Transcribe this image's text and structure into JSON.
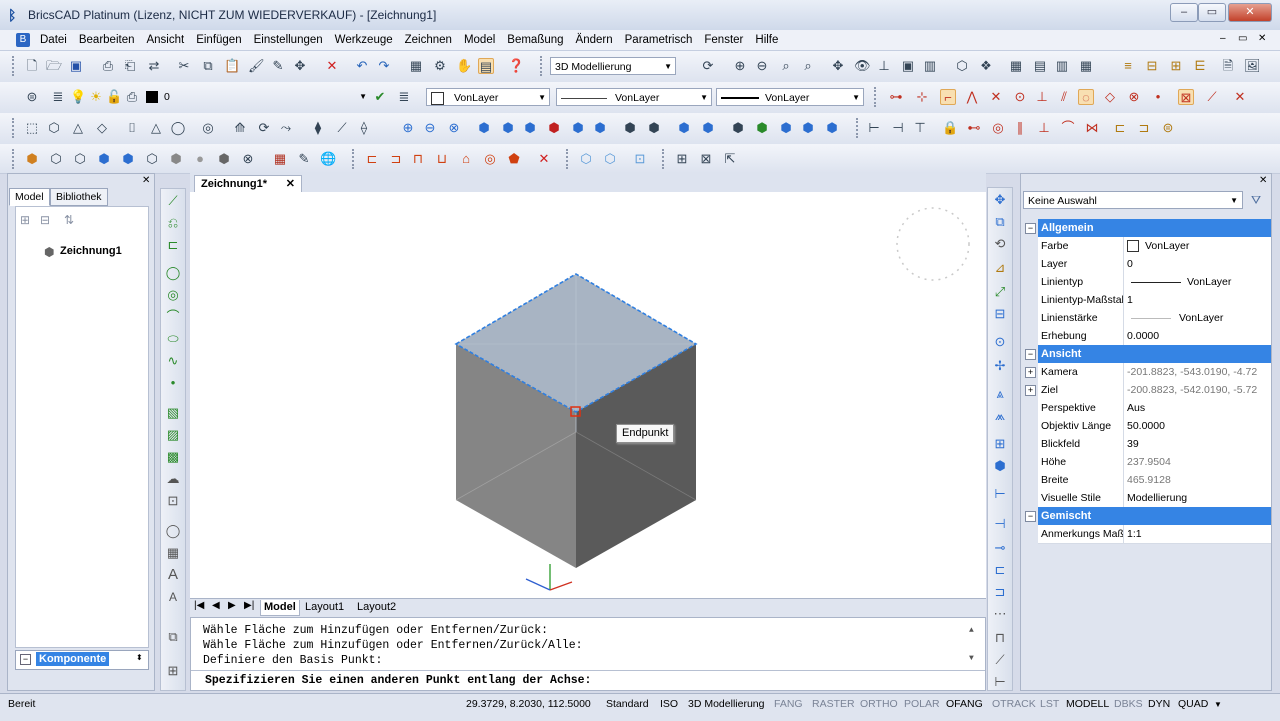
{
  "window": {
    "title": "BricsCAD Platinum (Lizenz, NICHT ZUM WIEDERVERKAUF) - [Zeichnung1]"
  },
  "menu": [
    "Datei",
    "Bearbeiten",
    "Ansicht",
    "Einfügen",
    "Einstellungen",
    "Werkzeuge",
    "Zeichnen",
    "Model",
    "Bemaßung",
    "Ändern",
    "Parametrisch",
    "Fenster",
    "Hilfe"
  ],
  "toolbar": {
    "workspace": "3D Modellierung",
    "layer": "0",
    "color": "VonLayer",
    "linetype": "VonLayer",
    "lineweight": "VonLayer"
  },
  "left_panel": {
    "tabs": [
      "Model",
      "Bibliothek"
    ],
    "tree_root": "Zeichnung1",
    "component": "Komponente"
  },
  "drawing": {
    "doc_tab": "Zeichnung1*",
    "tooltip": "Endpunkt",
    "layout_tabs": [
      "Model",
      "Layout1",
      "Layout2"
    ]
  },
  "command": {
    "history": [
      "Wähle Fläche zum Hinzufügen oder Entfernen/Zurück:",
      "Wähle Fläche zum Hinzufügen oder Entfernen/Zurück/Alle:",
      "Definiere den Basis Punkt:"
    ],
    "prompt": "Spezifizieren Sie einen anderen Punkt entlang der Achse:"
  },
  "properties": {
    "selection": "Keine Auswahl",
    "general": {
      "header": "Allgemein",
      "rows": [
        {
          "key": "Farbe",
          "value": "VonLayer"
        },
        {
          "key": "Layer",
          "value": "0"
        },
        {
          "key": "Linientyp",
          "value": "VonLayer"
        },
        {
          "key": "Linientyp-Maßstab",
          "value": "1"
        },
        {
          "key": "Linienstärke",
          "value": "VonLayer"
        },
        {
          "key": "Erhebung",
          "value": "0.0000"
        }
      ]
    },
    "view": {
      "header": "Ansicht",
      "rows": [
        {
          "key": "Kamera",
          "value": "-201.8823, -543.0190, -4.72"
        },
        {
          "key": "Ziel",
          "value": "-200.8823, -542.0190, -5.72"
        },
        {
          "key": "Perspektive",
          "value": "Aus"
        },
        {
          "key": "Objektiv Länge",
          "value": "50.0000"
        },
        {
          "key": "Blickfeld",
          "value": "39"
        },
        {
          "key": "Höhe",
          "value": "237.9504"
        },
        {
          "key": "Breite",
          "value": "465.9128"
        },
        {
          "key": "Visuelle Stile",
          "value": "Modellierung"
        }
      ]
    },
    "misc": {
      "header": "Gemischt",
      "rows": [
        {
          "key": "Anmerkungs Maß",
          "value": "1:1"
        }
      ]
    }
  },
  "status": {
    "left": "Bereit",
    "coords": "29.3729, 8.2030, 112.5000",
    "items": [
      "Standard",
      "ISO",
      "3D Modellierung",
      "FANG",
      "RASTER",
      "ORTHO",
      "POLAR",
      "OFANG",
      "OTRACK",
      "LST",
      "MODELL",
      "DBKS",
      "DYN",
      "QUAD"
    ]
  },
  "colors": {
    "accent": "#3584e4",
    "cube_top": "#a8b4c3",
    "cube_left": "#858585",
    "cube_right": "#5a5a5a",
    "edge": "#2f7fe0"
  }
}
